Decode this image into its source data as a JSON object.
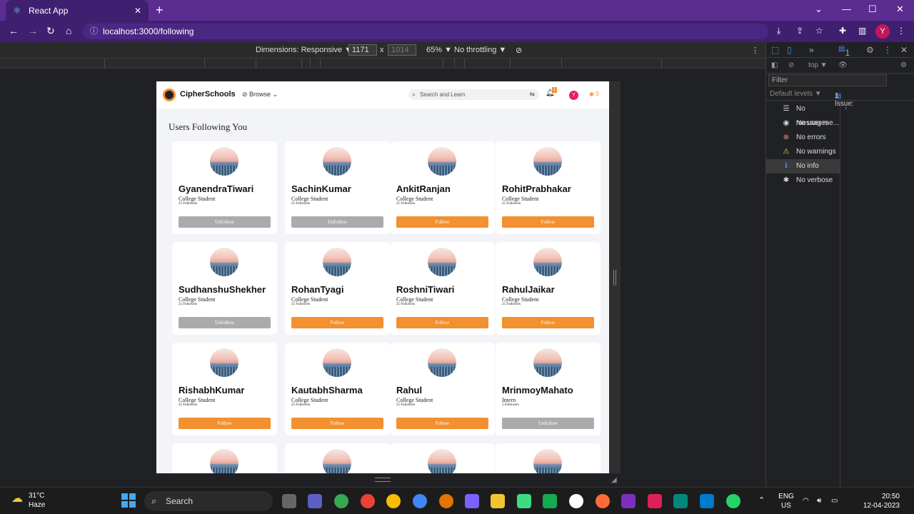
{
  "browser": {
    "tab_title": "React App",
    "url": "localhost:3000/following",
    "profile_initial": "Y"
  },
  "devtools_toolbar": {
    "dimensions": "Dimensions: Responsive ▼",
    "width": "1171",
    "x": "x",
    "height_placeholder": "1014",
    "zoom": "65% ▼",
    "throttling": "No throttling ▼"
  },
  "app": {
    "brand": "CipherSchools",
    "browse": "Browse",
    "search_placeholder": "Search and Learn",
    "notif_count": "1",
    "user_initial": "Y",
    "coins": "0",
    "page_title": "Users Following You"
  },
  "users": [
    {
      "name": "GyanendraTiwari",
      "role": "College Student",
      "followers": "25 Followers",
      "action": "Unfollow"
    },
    {
      "name": "SachinKumar",
      "role": "College Student",
      "followers": "25 Followers",
      "action": "Unfollow"
    },
    {
      "name": "AnkitRanjan",
      "role": "College Student",
      "followers": "25 Followers",
      "action": "Follow"
    },
    {
      "name": "RohitPrabhakar",
      "role": "College Student",
      "followers": "25 Followers",
      "action": "Follow"
    },
    {
      "name": "SudhanshuShekher",
      "role": "College Student",
      "followers": "25 Followers",
      "action": "Unfollow"
    },
    {
      "name": "RohanTyagi",
      "role": "College Student",
      "followers": "25 Followers",
      "action": "Follow"
    },
    {
      "name": "RoshniTiwari",
      "role": "College Student",
      "followers": "25 Followers",
      "action": "Follow"
    },
    {
      "name": "RahulJaikar",
      "role": "College Student",
      "followers": "25 Followers",
      "action": "Follow"
    },
    {
      "name": "RishabhKumar",
      "role": "College Student",
      "followers": "25 Followers",
      "action": "Follow"
    },
    {
      "name": "KautabhSharma",
      "role": "College Student",
      "followers": "25 Followers",
      "action": "Follow"
    },
    {
      "name": "Rahul",
      "role": "College Student",
      "followers": "25 Followers",
      "action": "Follow"
    },
    {
      "name": "MrinmoyMahato",
      "role": "Intern",
      "followers": "5 Followers",
      "action": "Unfollow"
    }
  ],
  "console": {
    "context": "top ▼",
    "filter_placeholder": "Filter",
    "default_levels": "Default levels ▼",
    "issues": "1 Issue: ",
    "issues_count": "1",
    "messages_badge": "1",
    "levels": [
      {
        "label": "No messages",
        "icon": "list-icon"
      },
      {
        "label": "No user me...",
        "icon": "user-icon"
      },
      {
        "label": "No errors",
        "icon": "error-icon"
      },
      {
        "label": "No warnings",
        "icon": "warning-icon"
      },
      {
        "label": "No info",
        "icon": "info-icon"
      },
      {
        "label": "No verbose",
        "icon": "bug-icon"
      }
    ]
  },
  "taskbar": {
    "temp": "31°C",
    "weather": "Haze",
    "search": "Search",
    "lang": "ENG",
    "region": "US",
    "time": "20:50",
    "date": "12-04-2023"
  },
  "colors": {
    "follow": "#f3902f",
    "unfollow": "#a9abad",
    "accent": "#5c2d91"
  }
}
